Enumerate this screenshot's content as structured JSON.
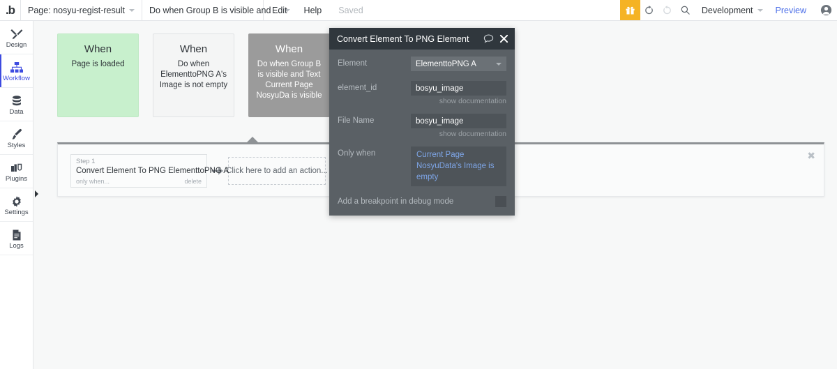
{
  "topbar": {
    "logo": "bubble-logo",
    "page_selector": {
      "label": "Page: nosyu-regist-result",
      "icon": "chevron-down-icon"
    },
    "workflow_selector": {
      "label": "Do when Group B is visible and ...",
      "icon": "chevron-down-icon"
    },
    "edit_label": "Edit",
    "help_label": "Help",
    "saved_label": "Saved",
    "gift_icon": "gift-icon",
    "undo_icon": "undo-icon",
    "redo_icon": "redo-icon",
    "search_icon": "search-icon",
    "version_selector": {
      "label": "Development",
      "icon": "chevron-down-icon"
    },
    "preview_label": "Preview",
    "avatar_icon": "user-avatar-icon",
    "accent_yellow": "#f5b324",
    "link_blue": "#4b6ee8"
  },
  "sidebar": {
    "items": [
      {
        "label": "Design",
        "icon": "design-icon",
        "active": false
      },
      {
        "label": "Workflow",
        "icon": "workflow-icon",
        "active": true
      },
      {
        "label": "Data",
        "icon": "database-icon",
        "active": false
      },
      {
        "label": "Styles",
        "icon": "brush-icon",
        "active": false
      },
      {
        "label": "Plugins",
        "icon": "plugins-icon",
        "active": false
      },
      {
        "label": "Settings",
        "icon": "gear-icon",
        "active": false
      },
      {
        "label": "Logs",
        "icon": "logs-icon",
        "active": false
      }
    ],
    "collapse_icon": "collapse-arrow-icon",
    "active_color": "#3d4be0"
  },
  "workflow": {
    "events": [
      {
        "title": "When",
        "subtitle": "Page is loaded",
        "style": "green",
        "color": "#c8f0cd"
      },
      {
        "title": "When",
        "subtitle": "Do when ElementtoPNG A's Image is not empty",
        "style": "plain",
        "color": "#f4f5f5"
      },
      {
        "title": "When",
        "subtitle": "Do when Group B is visible and Text Current Page NosyuDa is visible",
        "style": "selected",
        "color": "#9b9b9b"
      }
    ],
    "action_panel": {
      "close_icon": "close-icon",
      "step": {
        "number_label": "Step 1",
        "title": "Convert Element To PNG ElementtoPNG A",
        "only_when_label": "only when...",
        "delete_label": "delete"
      },
      "arrow_icon": "arrow-right-icon",
      "add_action_label": "Click here to add an action..."
    }
  },
  "dialog": {
    "title": "Convert Element To PNG Element",
    "comment_icon": "comment-bubble-icon",
    "close_icon": "close-icon",
    "fields": [
      {
        "label": "Element",
        "type": "select",
        "value": "ElementtoPNG A",
        "icon": "chevron-down-icon"
      },
      {
        "label": "element_id",
        "type": "text",
        "value": "bosyu_image",
        "doc_link": "show documentation"
      },
      {
        "label": "File Name",
        "type": "text",
        "value": "bosyu_image",
        "doc_link": "show documentation"
      },
      {
        "label": "Only when",
        "type": "expression",
        "value": "Current Page NosyuData's Image is empty"
      }
    ],
    "breakpoint": {
      "label": "Add a breakpoint in debug mode",
      "checked": false
    },
    "header_bg": "#30373d",
    "body_bg": "#5a6065",
    "expression_color": "#7ea6e8"
  }
}
